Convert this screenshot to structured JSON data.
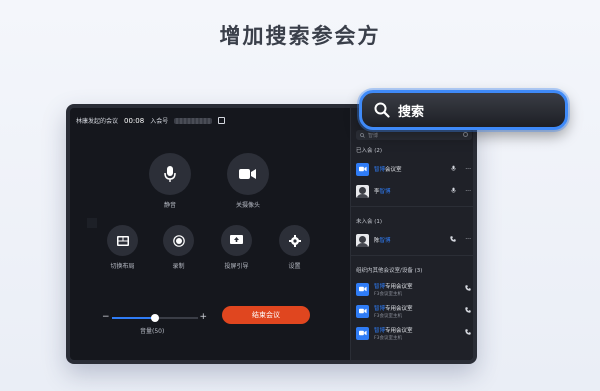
{
  "headline": "增加搜索参会方",
  "meeting": {
    "host_title": "林康发起的会议",
    "duration": "00:08",
    "meeting_id_label": "入会号"
  },
  "controls": {
    "mute": "静音",
    "camera_off": "关摄像头",
    "switch_layout": "切换布局",
    "record": "录制",
    "screen_cast": "投屏引导",
    "settings": "设置"
  },
  "volume": {
    "label": "音量(50)",
    "level": 50
  },
  "end_button": "结束会议",
  "panel": {
    "search_placeholder": "智博",
    "joined_header": "已入会 (2)",
    "joined": [
      {
        "name_hl": "智博",
        "name_rest": "会议室"
      },
      {
        "name_pre": "李",
        "name_hl": "智博"
      }
    ],
    "not_joined_header": "未入会 (1)",
    "not_joined": [
      {
        "name_pre": "陈",
        "name_hl": "智博"
      }
    ],
    "org_header": "组织内其他会议室/设备 (3)",
    "org_devices": [
      {
        "name_hl": "智博",
        "name_rest": "专用会议室",
        "sub": "F3会议室主机"
      },
      {
        "name_hl": "智博",
        "name_rest": "专用会议室",
        "sub": "F3会议室主机"
      },
      {
        "name_hl": "智博",
        "name_rest": "专用会议室",
        "sub": "F3会议室主机"
      }
    ]
  },
  "callout": {
    "label": "搜索"
  },
  "colors": {
    "accent": "#2f7cf6",
    "end": "#e0461f"
  }
}
